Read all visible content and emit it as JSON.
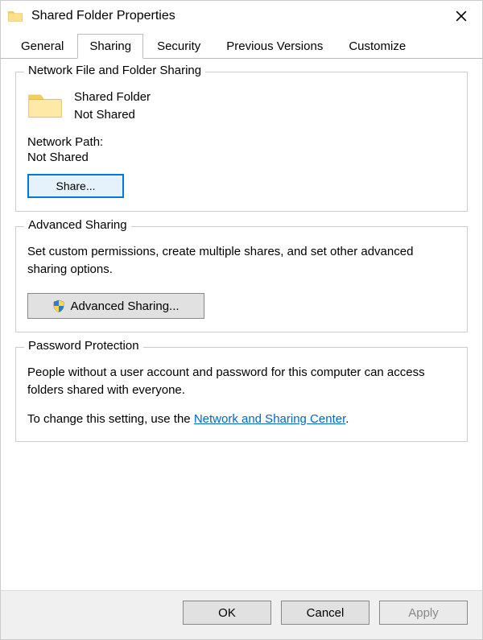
{
  "window": {
    "title": "Shared Folder Properties"
  },
  "tabs": {
    "general": "General",
    "sharing": "Sharing",
    "security": "Security",
    "previous": "Previous Versions",
    "customize": "Customize"
  },
  "network_sharing": {
    "title": "Network File and Folder Sharing",
    "folder_name": "Shared Folder",
    "status": "Not Shared",
    "path_label": "Network Path:",
    "path_value": "Not Shared",
    "share_button": "Share..."
  },
  "advanced_sharing": {
    "title": "Advanced Sharing",
    "description": "Set custom permissions, create multiple shares, and set other advanced sharing options.",
    "button": "Advanced Sharing..."
  },
  "password": {
    "title": "Password Protection",
    "description": "People without a user account and password for this computer can access folders shared with everyone.",
    "change_prefix": "To change this setting, use the ",
    "link": "Network and Sharing Center",
    "change_suffix": "."
  },
  "buttons": {
    "ok": "OK",
    "cancel": "Cancel",
    "apply": "Apply"
  }
}
